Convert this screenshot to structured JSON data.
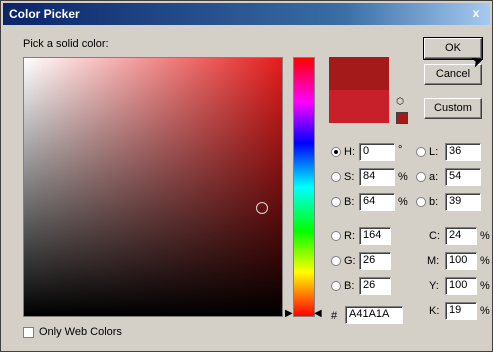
{
  "window": {
    "title": "Color Picker",
    "close_glyph": "x"
  },
  "prompt": "Pick a solid color:",
  "buttons": {
    "ok": "OK",
    "cancel": "Cancel",
    "custom": "Custom"
  },
  "hsb": {
    "h": {
      "label": "H:",
      "value": "0",
      "unit": "°"
    },
    "s": {
      "label": "S:",
      "value": "84",
      "unit": "%"
    },
    "b": {
      "label": "B:",
      "value": "64",
      "unit": "%"
    }
  },
  "lab": {
    "l": {
      "label": "L:",
      "value": "36"
    },
    "a": {
      "label": "a:",
      "value": "54"
    },
    "b": {
      "label": "b:",
      "value": "39"
    }
  },
  "rgb": {
    "r": {
      "label": "R:",
      "value": "164"
    },
    "g": {
      "label": "G:",
      "value": "26"
    },
    "b": {
      "label": "B:",
      "value": "26"
    }
  },
  "cmyk": {
    "c": {
      "label": "C:",
      "value": "24",
      "unit": "%"
    },
    "m": {
      "label": "M:",
      "value": "100",
      "unit": "%"
    },
    "y": {
      "label": "Y:",
      "value": "100",
      "unit": "%"
    },
    "k": {
      "label": "K:",
      "value": "19",
      "unit": "%"
    }
  },
  "hex": {
    "label": "#",
    "value": "A41A1A"
  },
  "web_only": {
    "label": "Only Web Colors",
    "checked": false
  },
  "colors": {
    "current": "#a41a1a",
    "previous": "#c8202b"
  }
}
